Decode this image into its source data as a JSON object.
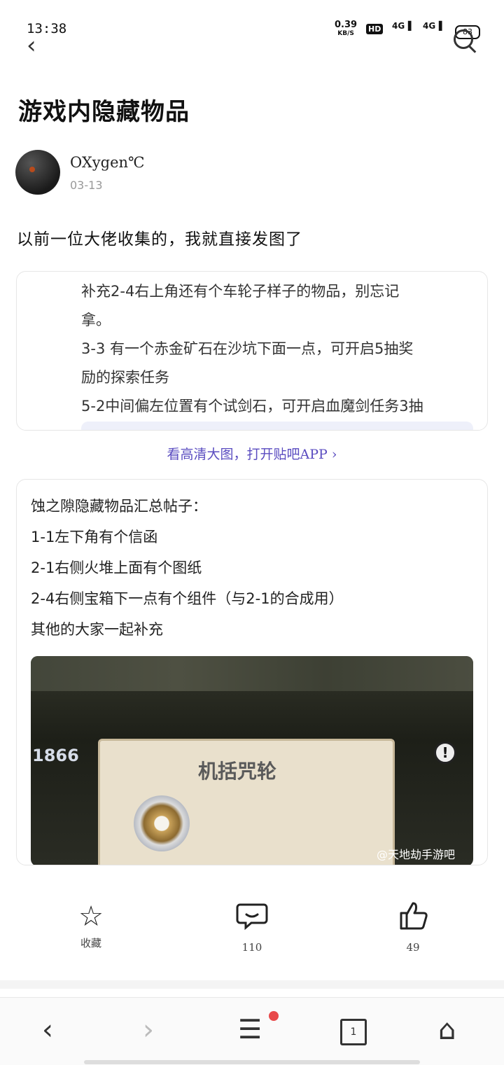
{
  "status_bar": {
    "time": "13:38",
    "net_speed": "0.39",
    "net_unit": "KB/S",
    "hd_badge": "HD",
    "sig1": "4G",
    "sig2": "4G",
    "battery": "83"
  },
  "post": {
    "title": "游戏内隐藏物品",
    "author": "OXygen℃",
    "date": "03-13",
    "lead": "以前一位大佬收集的，我就直接发图了"
  },
  "quote_card": {
    "lines": [
      "补充2-4右上角还有个车轮子样子的物品，别忘记",
      "拿。",
      "3-3 有一个赤金矿石在沙坑下面一点，可开启5抽奖",
      "励的探索任务",
      "5-2中间偏左位置有个试剑石，可开启血魔剑任务3抽"
    ]
  },
  "hd_link": "看高清大图，打开贴吧APP ›",
  "main_card": {
    "lines": [
      "蚀之隙隐藏物品汇总帖子：",
      "1-1左下角有个信函",
      "2-1右侧火堆上面有个图纸",
      "2-4右侧宝箱下一点有个组件（与2-1的合成用）",
      "其他的大家一起补充"
    ],
    "image": {
      "number": "1866",
      "panel_title": "机括咒轮",
      "warn_mark": "!",
      "watermark": "@天地劫手游吧"
    }
  },
  "actions": {
    "collect_label": "收藏",
    "comment_count": "110",
    "like_count": "49"
  },
  "browser_nav": {
    "tab_count": "1"
  },
  "colors": {
    "accent": "#5a4cc0",
    "badge_dot": "#e8494a"
  }
}
